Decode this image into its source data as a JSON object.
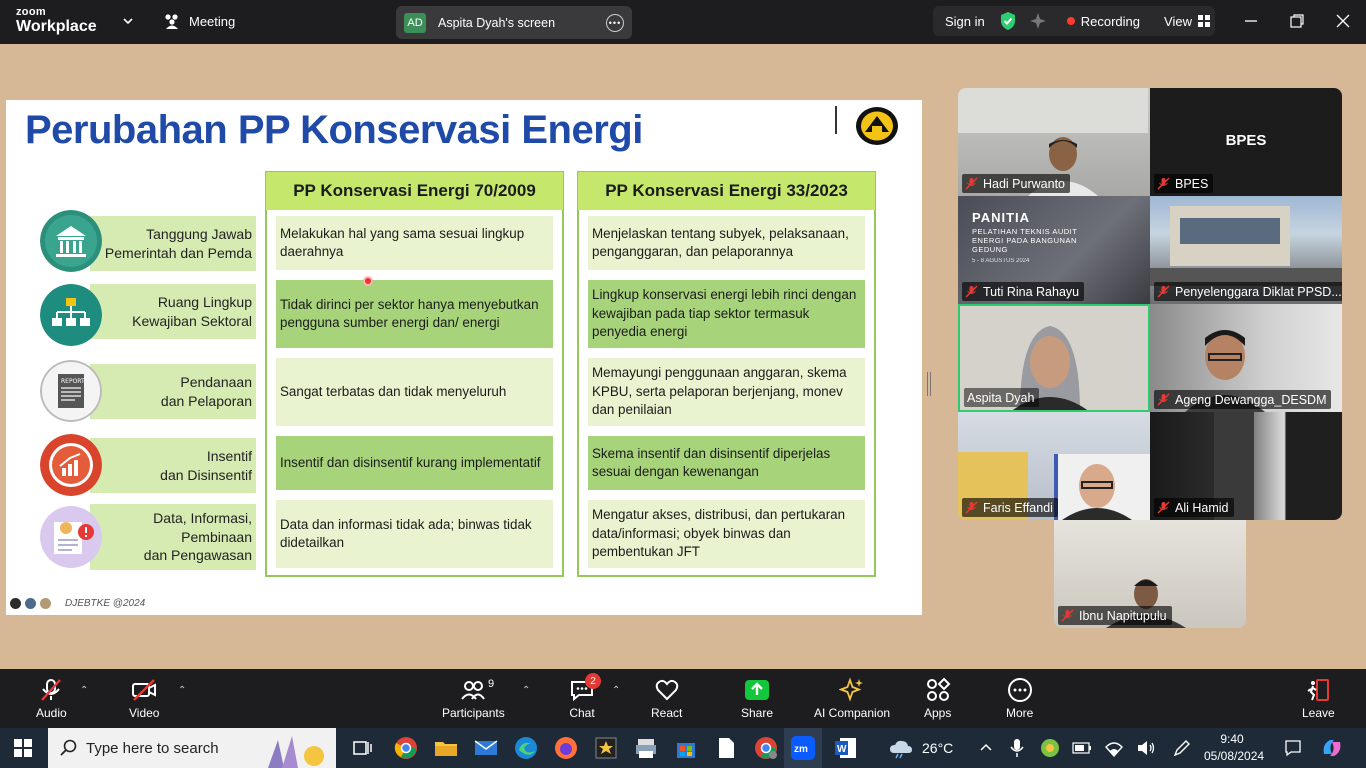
{
  "app": {
    "logo_top": "zoom",
    "logo_bottom": "Workplace",
    "meeting_label": "Meeting",
    "screen_share_initials": "AD",
    "screen_share_label": "Aspita Dyah's screen",
    "sign_in": "Sign in",
    "recording": "Recording",
    "view": "View"
  },
  "slide": {
    "title": "Perubahan PP Konservasi Energi",
    "col1_header": "PP Konservasi Energi 70/2009",
    "col2_header": "PP Konservasi Energi 33/2023",
    "rows": [
      {
        "label": "Tanggung Jawab\nPemerintah dan Pemda",
        "old": "Melakukan hal yang sama sesuai lingkup daerahnya",
        "new": "Menjelaskan tentang subyek, pelaksanaan, penganggaran, dan pelaporannya"
      },
      {
        "label": "Ruang Lingkup\nKewajiban Sektoral",
        "old": "Tidak dirinci per sektor hanya menyebutkan pengguna sumber energi dan/ energi",
        "new": "Lingkup konservasi energi lebih rinci dengan kewajiban pada tiap sektor termasuk penyedia energi"
      },
      {
        "label": "Pendanaan\ndan Pelaporan",
        "old": "Sangat terbatas dan tidak menyeluruh",
        "new": "Memayungi penggunaan anggaran, skema KPBU, serta pelaporan berjenjang, monev dan penilaian"
      },
      {
        "label": "Insentif\ndan Disinsentif",
        "old": "Insentif dan disinsentif kurang implementatif",
        "new": "Skema insentif dan disinsentif diperjelas sesuai dengan kewenangan"
      },
      {
        "label": "Data, Informasi,\nPembinaan\ndan Pengawasan",
        "old": "Data dan informasi tidak ada; binwas tidak didetailkan",
        "new": "Mengatur akses, distribusi, dan pertukaran data/informasi; obyek binwas dan pembentukan JFT"
      }
    ],
    "footer": "DJEBTKE @2024",
    "report_icon_text": "REPORT"
  },
  "participants": [
    {
      "name": "Hadi Purwanto"
    },
    {
      "name": "BPES",
      "placeholder": "BPES"
    },
    {
      "name": "Tuti Rina Rahayu",
      "banner_title": "PANITIA",
      "banner_sub": "PELATIHAN TEKNIS AUDIT ENERGI PADA BANGUNAN GEDUNG",
      "banner_date": "5 - 8 AGUSTUS 2024"
    },
    {
      "name": "Penyelenggara Diklat PPSD..."
    },
    {
      "name": "Aspita Dyah"
    },
    {
      "name": "Ageng Dewangga_DESDM"
    },
    {
      "name": "Faris Effandi"
    },
    {
      "name": "Ali Hamid"
    },
    {
      "name": "Ibnu Napitupulu"
    }
  ],
  "toolbar": {
    "audio": "Audio",
    "video": "Video",
    "participants": "Participants",
    "participants_count": "9",
    "chat": "Chat",
    "chat_badge": "2",
    "react": "React",
    "share": "Share",
    "ai_companion": "AI Companion",
    "apps": "Apps",
    "more": "More",
    "leave": "Leave"
  },
  "taskbar": {
    "search_placeholder": "Type here to search",
    "weather": "26°C",
    "time": "9:40",
    "date": "05/08/2024"
  },
  "colors": {
    "title_blue": "#1f4aa8",
    "header_green": "#c5e86c",
    "cell_light": "#eaf3cf",
    "cell_dark": "#a7d47a",
    "active_speaker": "#2ecc71",
    "share_green": "#13c73c",
    "recording_red": "#ff3b30"
  }
}
